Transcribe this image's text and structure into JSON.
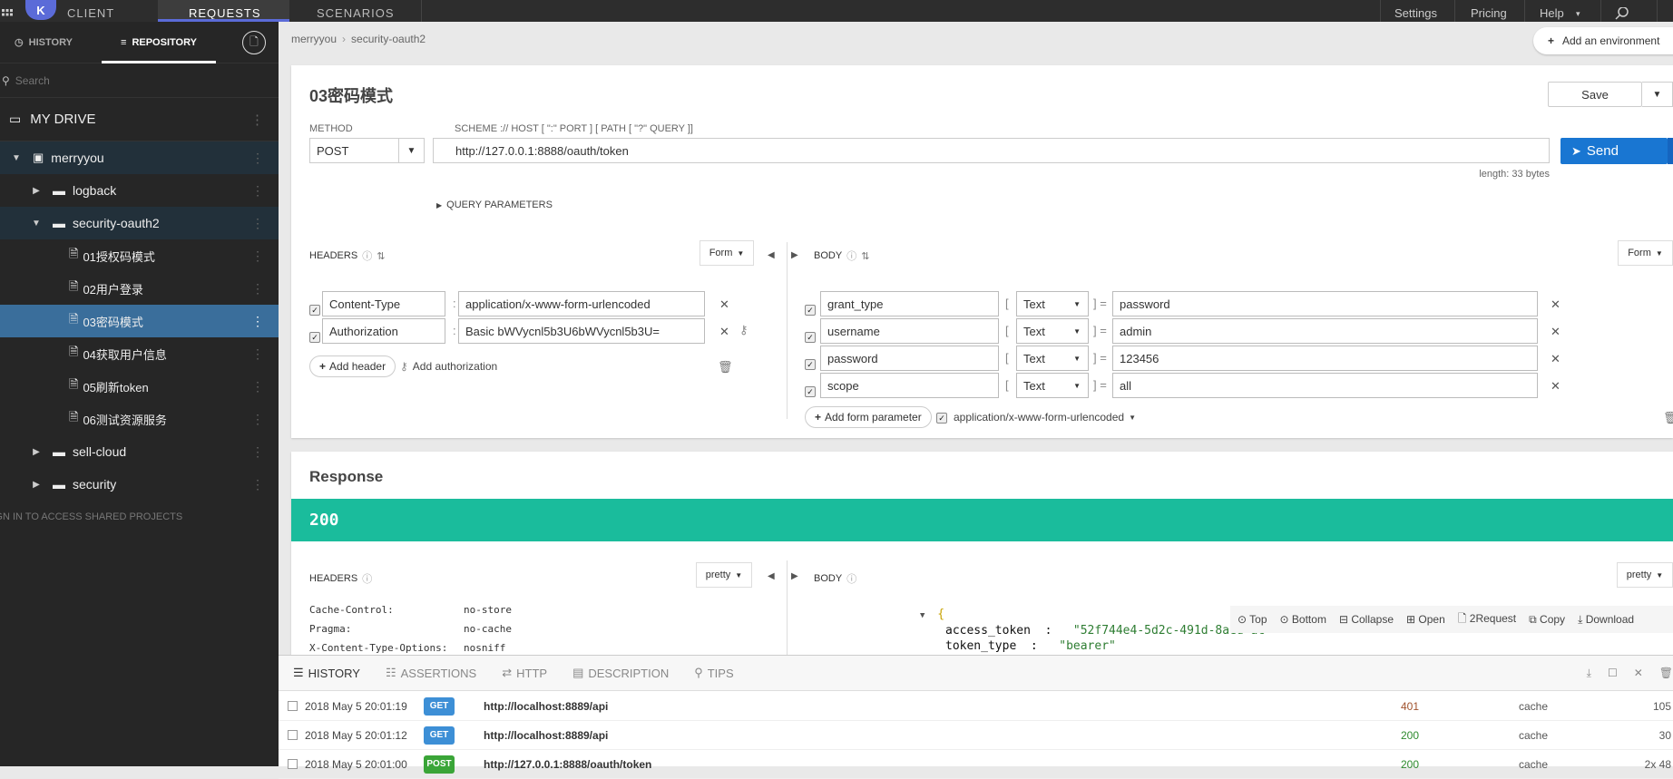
{
  "topbar": {
    "logo_letter": "K",
    "app_name": "CLIENT",
    "tabs": [
      "REQUESTS",
      "SCENARIOS"
    ],
    "links": [
      "Settings",
      "Pricing",
      "Help"
    ]
  },
  "sidebar": {
    "tabs": {
      "history": "HISTORY",
      "repository": "REPOSITORY"
    },
    "search_placeholder": "Search",
    "drive_label": "MY DRIVE",
    "tree": [
      {
        "label": "merryyou",
        "kind": "project"
      },
      {
        "label": "logback",
        "kind": "folder"
      },
      {
        "label": "security-oauth2",
        "kind": "folder"
      },
      {
        "label": "01授权码模式",
        "kind": "request"
      },
      {
        "label": "02用户登录",
        "kind": "request"
      },
      {
        "label": "03密码模式",
        "kind": "request"
      },
      {
        "label": "04获取用户信息",
        "kind": "request"
      },
      {
        "label": "05刷新token",
        "kind": "request"
      },
      {
        "label": "06测试资源服务",
        "kind": "request"
      },
      {
        "label": "sell-cloud",
        "kind": "folder"
      },
      {
        "label": "security",
        "kind": "folder"
      }
    ],
    "footer": "SIGN IN TO ACCESS SHARED PROJECTS"
  },
  "breadcrumb": [
    "merryyou",
    "security-oauth2"
  ],
  "environment_button": "Add an environment",
  "request": {
    "title": "03密码模式",
    "save_label": "Save",
    "method_label": "METHOD",
    "method": "POST",
    "scheme_label": "SCHEME :// HOST [ \":\" PORT ] [ PATH [ \"?\" QUERY ]]",
    "url": "http://127.0.0.1:8888/oauth/token",
    "length": "length: 33 bytes",
    "send_label": "Send",
    "query_params": "QUERY PARAMETERS",
    "headers_label": "HEADERS",
    "headers_mode": "Form",
    "headers": [
      {
        "name": "Content-Type",
        "value": "application/x-www-form-urlencoded"
      },
      {
        "name": "Authorization",
        "value": "Basic bWVycnl5b3U6bWVycnl5b3U="
      }
    ],
    "add_header": "Add header",
    "add_authorization": "Add authorization",
    "body_label": "BODY",
    "body_mode": "Form",
    "body": [
      {
        "name": "grant_type",
        "type": "Text",
        "value": "password"
      },
      {
        "name": "username",
        "type": "Text",
        "value": "admin"
      },
      {
        "name": "password",
        "type": "Text",
        "value": "123456"
      },
      {
        "name": "scope",
        "type": "Text",
        "value": "all"
      }
    ],
    "add_form_param": "Add form parameter",
    "content_type": "application/x-www-form-urlencoded"
  },
  "response": {
    "title": "Response",
    "status": "200",
    "headers_label": "HEADERS",
    "headers_mode": "pretty",
    "headers": [
      {
        "name": "Cache-Control:",
        "value": "no-store"
      },
      {
        "name": "Pragma:",
        "value": "no-cache"
      },
      {
        "name": "X-Content-Type-Options:",
        "value": "nosniff"
      }
    ],
    "body_label": "BODY",
    "body_mode": "pretty",
    "json_toolbar": [
      "Top",
      "Bottom",
      "Collapse",
      "Open",
      "2Request",
      "Copy",
      "Download"
    ],
    "json_open": "{",
    "json_lines": [
      {
        "key": "access_token",
        "value": "\"52f744e4-5d2c-491d-8aed-ac"
      },
      {
        "key": "token_type",
        "value": "\"bearer\""
      }
    ]
  },
  "bottom": {
    "tabs": [
      "HISTORY",
      "ASSERTIONS",
      "HTTP",
      "DESCRIPTION",
      "TIPS"
    ],
    "rows": [
      {
        "time": "2018 May 5 20:01:19",
        "method": "GET",
        "url": "http://localhost:8889/api",
        "status": "401",
        "cache": "cache",
        "size": "105"
      },
      {
        "time": "2018 May 5 20:01:12",
        "method": "GET",
        "url": "http://localhost:8889/api",
        "status": "200",
        "cache": "cache",
        "size": "30"
      },
      {
        "time": "2018 May 5 20:01:00",
        "method": "POST",
        "url": "http://127.0.0.1:8888/oauth/token",
        "status": "200",
        "cache": "cache",
        "size": "2x 48"
      }
    ]
  },
  "colors": {
    "accent": "#1976d2",
    "success": "#1abc9c",
    "get_badge": "#3d8fd6",
    "post_badge": "#3aa538",
    "status_error": "#a0522d",
    "status_ok": "#2e8b2e",
    "sidebar_bg": "#262626",
    "selected_row": "#3a6e9b"
  }
}
